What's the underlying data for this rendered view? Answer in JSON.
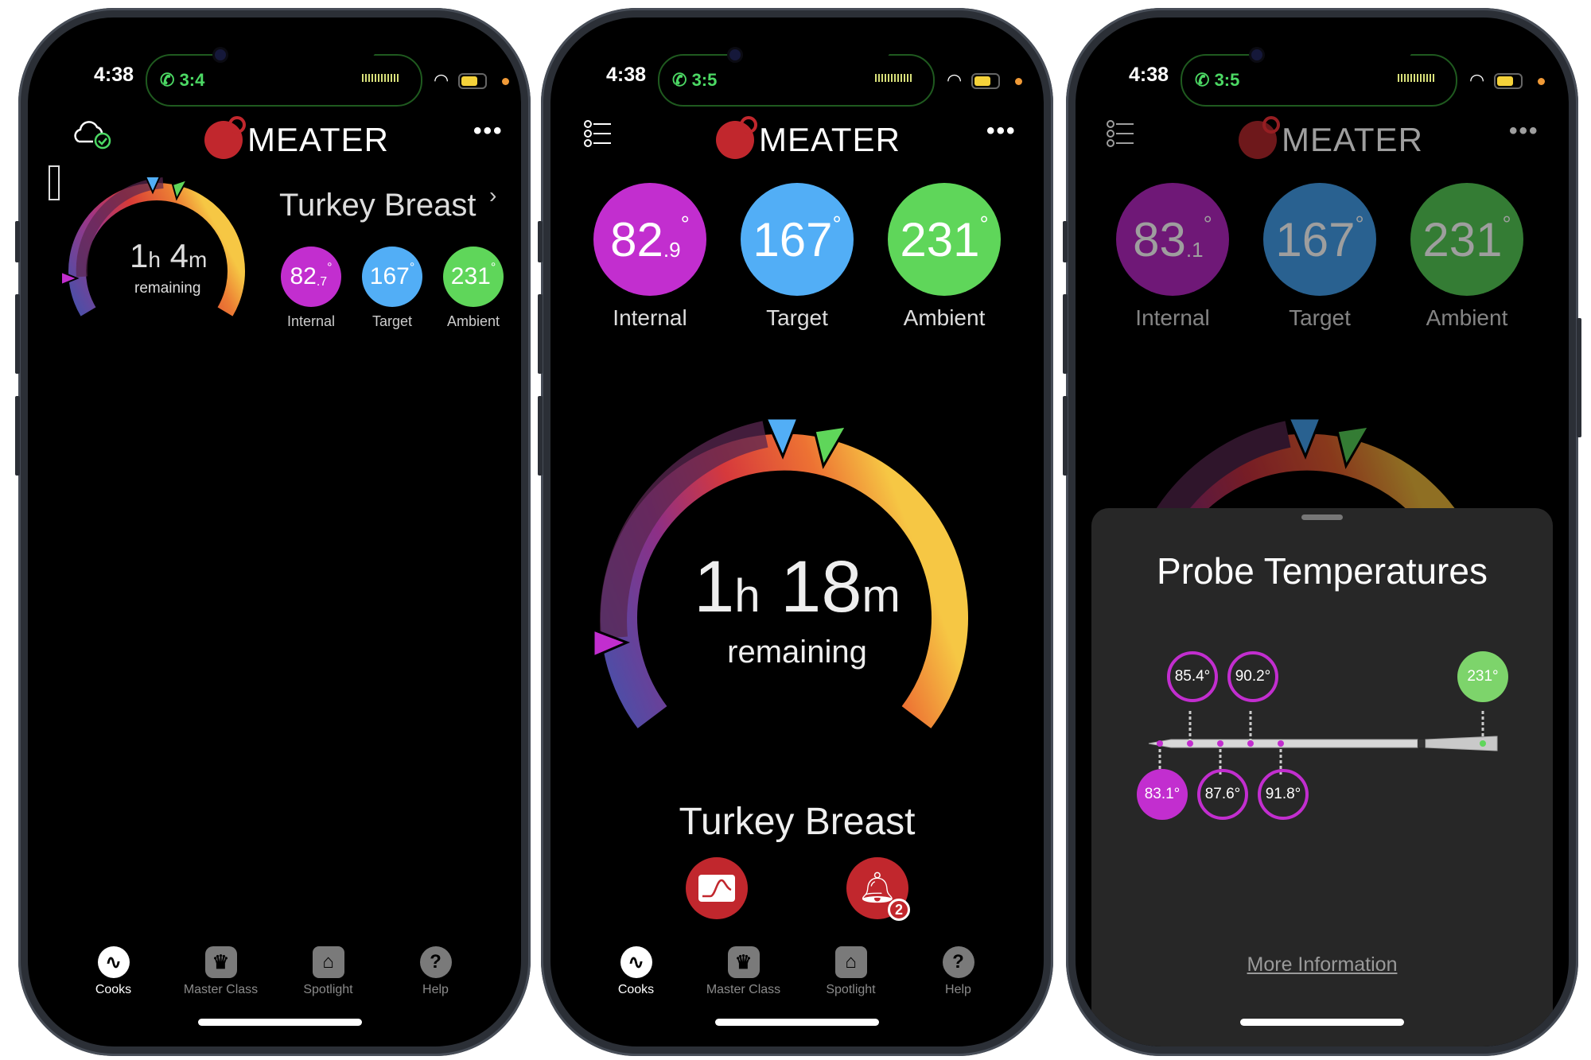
{
  "status_bar": {
    "time": "4:38",
    "wifi_icon": "wifi-icon",
    "battery_icon": "battery-icon"
  },
  "brand": {
    "name": "MEATER",
    "logo_color": "#c1272d"
  },
  "colors": {
    "internal": "#c22ecf",
    "target": "#52aef6",
    "ambient": "#5fd65a",
    "accent_red": "#c1272d",
    "sheet_bg": "#272727"
  },
  "labels": {
    "internal": "Internal",
    "target": "Target",
    "ambient": "Ambient",
    "remaining": "remaining",
    "more_dots": "•••"
  },
  "tabs": [
    {
      "label": "Cooks",
      "icon": "cooks-icon",
      "active": true
    },
    {
      "label": "Master Class",
      "icon": "chef-hat-icon",
      "active": false
    },
    {
      "label": "Spotlight",
      "icon": "spotlight-icon",
      "active": false
    },
    {
      "label": "Help",
      "icon": "help-icon",
      "active": false
    }
  ],
  "phones": [
    {
      "call_timer": "3:4",
      "cook_name": "Turkey Breast",
      "time_remaining": {
        "h": "1",
        "h_unit": "h",
        "m": "4",
        "m_unit": "m"
      },
      "internal": {
        "int": "82",
        "dec": ".7",
        "deg": "°"
      },
      "target": {
        "value": "167",
        "deg": "°"
      },
      "ambient": {
        "value": "231",
        "deg": "°"
      }
    },
    {
      "call_timer": "3:5",
      "cook_name": "Turkey Breast",
      "time_remaining": {
        "h": "1",
        "h_unit": "h",
        "m": "18",
        "m_unit": "m"
      },
      "internal": {
        "int": "82",
        "dec": ".9",
        "deg": "°"
      },
      "target": {
        "value": "167",
        "deg": "°"
      },
      "ambient": {
        "value": "231",
        "deg": "°"
      },
      "alerts_badge": "2"
    },
    {
      "call_timer": "3:5",
      "internal": {
        "int": "83",
        "dec": ".1",
        "deg": "°"
      },
      "target": {
        "value": "167",
        "deg": "°"
      },
      "ambient": {
        "value": "231",
        "deg": "°"
      },
      "sheet": {
        "title": "Probe Temperatures",
        "sensors": [
          "83.1°",
          "85.4°",
          "87.6°",
          "90.2°",
          "91.8°"
        ],
        "ambient_sensor": "231°",
        "more_info": "More Information"
      }
    }
  ]
}
